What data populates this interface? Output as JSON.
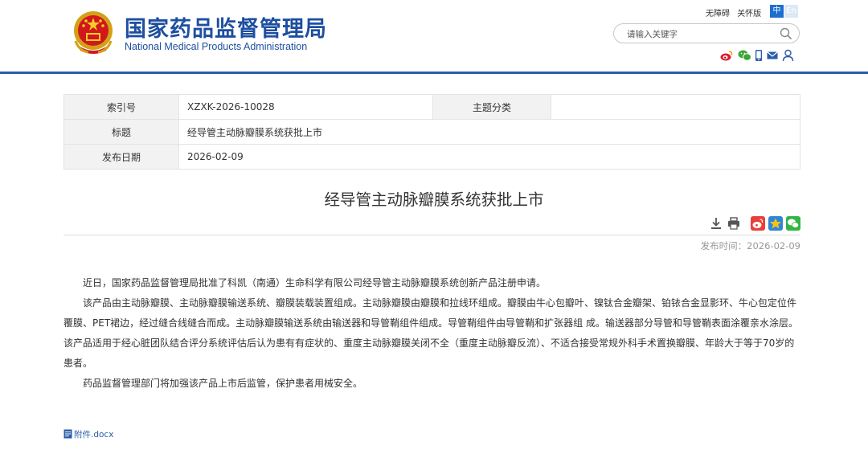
{
  "header": {
    "site_name_cn": "国家药品监督管理局",
    "site_name_en": "National Medical Products Administration",
    "accessibility_link": "无障碍",
    "care_mode_link": "关怀版",
    "lang_cn": "中",
    "lang_en": "En",
    "search_placeholder": "请输入关键字",
    "social_icons": [
      "weibo-icon",
      "wechat-icon",
      "mobile-icon",
      "mail-icon",
      "user-icon"
    ]
  },
  "metadata": {
    "index_label": "索引号",
    "index_value": "XZXK-2026-10028",
    "topic_label": "主题分类",
    "topic_value": "",
    "title_label": "标题",
    "title_value": "经导管主动脉瓣膜系统获批上市",
    "date_label": "发布日期",
    "date_value": "2026-02-09"
  },
  "article": {
    "title": "经导管主动脉瓣膜系统获批上市",
    "publish_time": "发布时间：2026-02-09",
    "tool_icons": [
      "download-icon",
      "print-icon"
    ],
    "share_icons": [
      "weibo-share-icon",
      "qzone-share-icon",
      "wechat-share-icon"
    ],
    "paragraphs": [
      "近日，国家药品监督管理局批准了科凯（南通）生命科学有限公司经导管主动脉瓣膜系统创新产品注册申请。",
      "该产品由主动脉瓣膜、主动脉瓣膜输送系统、瓣膜装载装置组成。主动脉瓣膜由瓣膜和拉线环组成。瓣膜由牛心包瓣叶、镍钛合金瓣架、铂铱合金显影环、牛心包定位件覆膜、PET裙边，经过缝合线缝合而成。主动脉瓣膜输送系统由输送器和导管鞘组件组成。导管鞘组件由导管鞘和扩张器组 成。输送器部分导管和导管鞘表面涂覆亲水涂层。该产品适用于经心脏团队结合评分系统评估后认为患有有症状的、重度主动脉瓣膜关闭不全（重度主动脉瓣反流）、不适合接受常规外科手术置换瓣膜、年龄大于等于70岁的患者。",
      "药品监督管理部门将加强该产品上市后监管，保护患者用械安全。"
    ],
    "attachment": "附件.docx"
  }
}
